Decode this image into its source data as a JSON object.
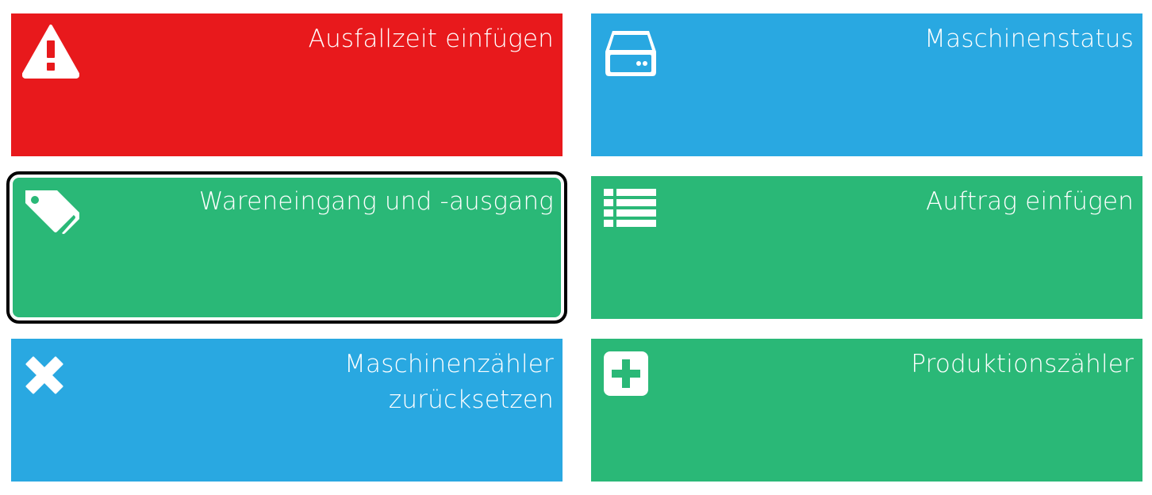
{
  "tiles": [
    {
      "id": "downtime",
      "label": "Ausfallzeit einfügen",
      "color": "#e8191c",
      "icon": "warning-icon"
    },
    {
      "id": "machine-status",
      "label": "Maschinenstatus",
      "color": "#29a8e1",
      "icon": "hard-drive-icon"
    },
    {
      "id": "goods",
      "label": "Wareneingang und -ausgang",
      "color": "#2ab877",
      "icon": "tags-icon",
      "focused": true
    },
    {
      "id": "order",
      "label": "Auftrag einfügen",
      "color": "#2ab877",
      "icon": "list-icon"
    },
    {
      "id": "reset-counter",
      "label": "Maschinenzähler\nzurücksetzen",
      "color": "#29a8e1",
      "icon": "close-icon"
    },
    {
      "id": "production",
      "label": "Produktionszähler",
      "color": "#2ab877",
      "icon": "plus-square-icon"
    }
  ]
}
